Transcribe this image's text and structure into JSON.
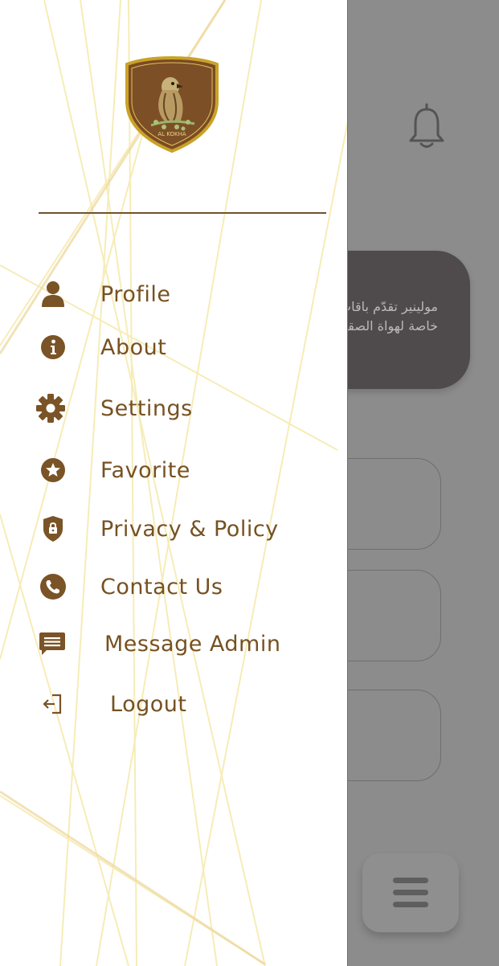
{
  "theme": {
    "accent": "#765122",
    "icon": "#7a5326",
    "logo_border": "#c9a227"
  },
  "logo": {
    "text": "AL KOKHA"
  },
  "menu": [
    {
      "label": "Profile",
      "icon": "person-icon"
    },
    {
      "label": "About",
      "icon": "info-icon"
    },
    {
      "label": "Settings",
      "icon": "gear-icon"
    },
    {
      "label": "Favorite",
      "icon": "star-icon"
    },
    {
      "label": "Privacy & Policy",
      "icon": "shield-lock-icon"
    },
    {
      "label": "Contact Us",
      "icon": "phone-icon"
    },
    {
      "label": "Message Admin",
      "icon": "message-icon"
    },
    {
      "label": "Logout",
      "icon": "logout-icon"
    }
  ],
  "background": {
    "banner_text_line1": "مولينير تقدّم باقات",
    "banner_text_line2": "خاصة لهواة الصقور"
  }
}
